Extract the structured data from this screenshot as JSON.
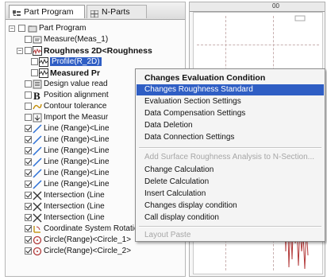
{
  "tabs": [
    {
      "label": "Part Program",
      "icon": "document-tree-icon"
    },
    {
      "label": "N-Parts",
      "icon": "grid-icon"
    }
  ],
  "tree": [
    {
      "label": "Part Program",
      "indent": 0
    },
    {
      "label": "Measure(Meas_1)",
      "indent": 1
    },
    {
      "label": "Roughness 2D<Roughness",
      "indent": 1
    },
    {
      "label": "Profile(R_2D)",
      "indent": 2
    },
    {
      "label": "Measured Pr",
      "indent": 2
    },
    {
      "label": "Design value read",
      "indent": 1
    },
    {
      "label": "Position alignment",
      "indent": 1
    },
    {
      "label": "Contour tolerance",
      "indent": 1
    },
    {
      "label": "Import the Measur",
      "indent": 1
    },
    {
      "label": "Line (Range)<Line",
      "indent": 1
    },
    {
      "label": "Line (Range)<Line",
      "indent": 1
    },
    {
      "label": "Line (Range)<Line",
      "indent": 1
    },
    {
      "label": "Line (Range)<Line",
      "indent": 1
    },
    {
      "label": "Line (Range)<Line",
      "indent": 1
    },
    {
      "label": "Line (Range)<Line",
      "indent": 1
    },
    {
      "label": "Intersection (Line",
      "indent": 1
    },
    {
      "label": "Intersection (Line",
      "indent": 1
    },
    {
      "label": "Intersection (Line",
      "indent": 1
    },
    {
      "label": "Coordinate System Rotation (Li",
      "indent": 1
    },
    {
      "label": "Circle(Range)<Circle_1>",
      "indent": 1
    },
    {
      "label": "Circle(Range)<Circle_2>",
      "indent": 1
    }
  ],
  "context_menu": {
    "header": "Changes Evaluation Condition",
    "items": [
      {
        "label": "Changes Roughness Standard",
        "state": "highlighted"
      },
      {
        "label": "Evaluation Section Settings",
        "state": "normal"
      },
      {
        "label": "Data Compensation Settings",
        "state": "normal"
      },
      {
        "label": "Data Deletion",
        "state": "normal"
      },
      {
        "label": "Data Connection Settings",
        "state": "normal"
      },
      {
        "label": "Add Surface Roughness Analysis to N-Section...",
        "state": "disabled"
      },
      {
        "label": "Change Calculation",
        "state": "normal"
      },
      {
        "label": "Delete Calculation",
        "state": "normal"
      },
      {
        "label": "Insert Calculation",
        "state": "normal"
      },
      {
        "label": "Changes display condition",
        "state": "normal"
      },
      {
        "label": "Call display condition",
        "state": "normal"
      },
      {
        "label": "Layout Paste",
        "state": "disabled"
      }
    ]
  },
  "graph": {
    "ruler_label": "00"
  },
  "colors": {
    "selection": "#2f5ec4",
    "check_icon": "#2a6fd6",
    "roughness_icon": "#b33a3a"
  }
}
